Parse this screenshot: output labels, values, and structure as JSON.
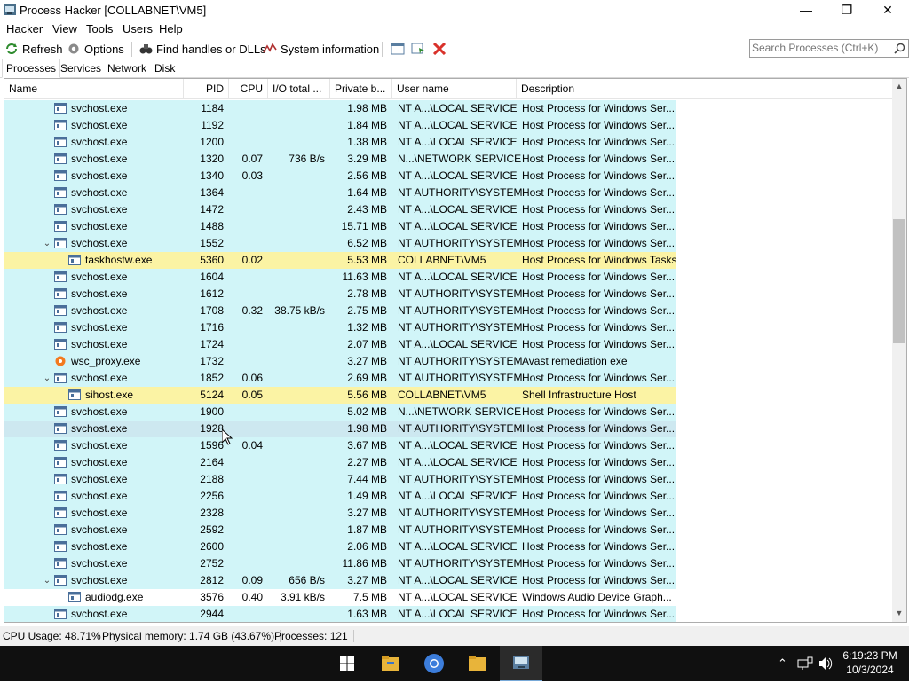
{
  "window": {
    "title": "Process Hacker [COLLABNET\\VM5]",
    "controls": {
      "minimize": "—",
      "maximize": "❐",
      "close": "✕"
    }
  },
  "menu": [
    "Hacker",
    "View",
    "Tools",
    "Users",
    "Help"
  ],
  "toolbar": {
    "refresh": "Refresh",
    "options": "Options",
    "find_handles": "Find handles or DLLs",
    "system_information": "System information"
  },
  "search": {
    "placeholder": "Search Processes (Ctrl+K)"
  },
  "tabs": [
    "Processes",
    "Services",
    "Network",
    "Disk"
  ],
  "columns": {
    "name": "Name",
    "pid": "PID",
    "cpu": "CPU",
    "io": "I/O total ...",
    "private": "Private b...",
    "user": "User name",
    "description": "Description"
  },
  "processes": [
    {
      "name": "svchost.exe",
      "pid": "1184",
      "cpu": "",
      "io": "",
      "priv": "1.98 MB",
      "user": "NT A...\\LOCAL SERVICE",
      "desc": "Host Process for Windows Ser...",
      "indent": 1,
      "kind": "svc",
      "expand": ""
    },
    {
      "name": "svchost.exe",
      "pid": "1192",
      "cpu": "",
      "io": "",
      "priv": "1.84 MB",
      "user": "NT A...\\LOCAL SERVICE",
      "desc": "Host Process for Windows Ser...",
      "indent": 1,
      "kind": "svc",
      "expand": ""
    },
    {
      "name": "svchost.exe",
      "pid": "1200",
      "cpu": "",
      "io": "",
      "priv": "1.38 MB",
      "user": "NT A...\\LOCAL SERVICE",
      "desc": "Host Process for Windows Ser...",
      "indent": 1,
      "kind": "svc",
      "expand": ""
    },
    {
      "name": "svchost.exe",
      "pid": "1320",
      "cpu": "0.07",
      "io": "736 B/s",
      "priv": "3.29 MB",
      "user": "N...\\NETWORK SERVICE",
      "desc": "Host Process for Windows Ser...",
      "indent": 1,
      "kind": "svc",
      "expand": ""
    },
    {
      "name": "svchost.exe",
      "pid": "1340",
      "cpu": "0.03",
      "io": "",
      "priv": "2.56 MB",
      "user": "NT A...\\LOCAL SERVICE",
      "desc": "Host Process for Windows Ser...",
      "indent": 1,
      "kind": "svc",
      "expand": ""
    },
    {
      "name": "svchost.exe",
      "pid": "1364",
      "cpu": "",
      "io": "",
      "priv": "1.64 MB",
      "user": "NT AUTHORITY\\SYSTEM",
      "desc": "Host Process for Windows Ser...",
      "indent": 1,
      "kind": "svc",
      "expand": ""
    },
    {
      "name": "svchost.exe",
      "pid": "1472",
      "cpu": "",
      "io": "",
      "priv": "2.43 MB",
      "user": "NT A...\\LOCAL SERVICE",
      "desc": "Host Process for Windows Ser...",
      "indent": 1,
      "kind": "svc",
      "expand": ""
    },
    {
      "name": "svchost.exe",
      "pid": "1488",
      "cpu": "",
      "io": "",
      "priv": "15.71 MB",
      "user": "NT A...\\LOCAL SERVICE",
      "desc": "Host Process for Windows Ser...",
      "indent": 1,
      "kind": "svc",
      "expand": ""
    },
    {
      "name": "svchost.exe",
      "pid": "1552",
      "cpu": "",
      "io": "",
      "priv": "6.52 MB",
      "user": "NT AUTHORITY\\SYSTEM",
      "desc": "Host Process for Windows Ser...",
      "indent": 1,
      "kind": "svc",
      "expand": "v"
    },
    {
      "name": "taskhostw.exe",
      "pid": "5360",
      "cpu": "0.02",
      "io": "",
      "priv": "5.53 MB",
      "user": "COLLABNET\\VM5",
      "desc": "Host Process for Windows Tasks",
      "indent": 2,
      "kind": "user",
      "expand": ""
    },
    {
      "name": "svchost.exe",
      "pid": "1604",
      "cpu": "",
      "io": "",
      "priv": "11.63 MB",
      "user": "NT A...\\LOCAL SERVICE",
      "desc": "Host Process for Windows Ser...",
      "indent": 1,
      "kind": "svc",
      "expand": ""
    },
    {
      "name": "svchost.exe",
      "pid": "1612",
      "cpu": "",
      "io": "",
      "priv": "2.78 MB",
      "user": "NT AUTHORITY\\SYSTEM",
      "desc": "Host Process for Windows Ser...",
      "indent": 1,
      "kind": "svc",
      "expand": ""
    },
    {
      "name": "svchost.exe",
      "pid": "1708",
      "cpu": "0.32",
      "io": "38.75 kB/s",
      "priv": "2.75 MB",
      "user": "NT AUTHORITY\\SYSTEM",
      "desc": "Host Process for Windows Ser...",
      "indent": 1,
      "kind": "svc",
      "expand": ""
    },
    {
      "name": "svchost.exe",
      "pid": "1716",
      "cpu": "",
      "io": "",
      "priv": "1.32 MB",
      "user": "NT AUTHORITY\\SYSTEM",
      "desc": "Host Process for Windows Ser...",
      "indent": 1,
      "kind": "svc",
      "expand": ""
    },
    {
      "name": "svchost.exe",
      "pid": "1724",
      "cpu": "",
      "io": "",
      "priv": "2.07 MB",
      "user": "NT A...\\LOCAL SERVICE",
      "desc": "Host Process for Windows Ser...",
      "indent": 1,
      "kind": "svc",
      "expand": ""
    },
    {
      "name": "wsc_proxy.exe",
      "pid": "1732",
      "cpu": "",
      "io": "",
      "priv": "3.27 MB",
      "user": "NT AUTHORITY\\SYSTEM",
      "desc": "Avast remediation exe",
      "indent": 1,
      "kind": "svc",
      "expand": "",
      "icon": "avast"
    },
    {
      "name": "svchost.exe",
      "pid": "1852",
      "cpu": "0.06",
      "io": "",
      "priv": "2.69 MB",
      "user": "NT AUTHORITY\\SYSTEM",
      "desc": "Host Process for Windows Ser...",
      "indent": 1,
      "kind": "svc",
      "expand": "v"
    },
    {
      "name": "sihost.exe",
      "pid": "5124",
      "cpu": "0.05",
      "io": "",
      "priv": "5.56 MB",
      "user": "COLLABNET\\VM5",
      "desc": "Shell Infrastructure Host",
      "indent": 2,
      "kind": "user",
      "expand": ""
    },
    {
      "name": "svchost.exe",
      "pid": "1900",
      "cpu": "",
      "io": "",
      "priv": "5.02 MB",
      "user": "N...\\NETWORK SERVICE",
      "desc": "Host Process for Windows Ser...",
      "indent": 1,
      "kind": "svc",
      "expand": ""
    },
    {
      "name": "svchost.exe",
      "pid": "1928",
      "cpu": "",
      "io": "",
      "priv": "1.98 MB",
      "user": "NT AUTHORITY\\SYSTEM",
      "desc": "Host Process for Windows Ser...",
      "indent": 1,
      "kind": "sel",
      "expand": ""
    },
    {
      "name": "svchost.exe",
      "pid": "1596",
      "cpu": "0.04",
      "io": "",
      "priv": "3.67 MB",
      "user": "NT A...\\LOCAL SERVICE",
      "desc": "Host Process for Windows Ser...",
      "indent": 1,
      "kind": "svc",
      "expand": ""
    },
    {
      "name": "svchost.exe",
      "pid": "2164",
      "cpu": "",
      "io": "",
      "priv": "2.27 MB",
      "user": "NT A...\\LOCAL SERVICE",
      "desc": "Host Process for Windows Ser...",
      "indent": 1,
      "kind": "svc",
      "expand": ""
    },
    {
      "name": "svchost.exe",
      "pid": "2188",
      "cpu": "",
      "io": "",
      "priv": "7.44 MB",
      "user": "NT AUTHORITY\\SYSTEM",
      "desc": "Host Process for Windows Ser...",
      "indent": 1,
      "kind": "svc",
      "expand": ""
    },
    {
      "name": "svchost.exe",
      "pid": "2256",
      "cpu": "",
      "io": "",
      "priv": "1.49 MB",
      "user": "NT A...\\LOCAL SERVICE",
      "desc": "Host Process for Windows Ser...",
      "indent": 1,
      "kind": "svc",
      "expand": ""
    },
    {
      "name": "svchost.exe",
      "pid": "2328",
      "cpu": "",
      "io": "",
      "priv": "3.27 MB",
      "user": "NT AUTHORITY\\SYSTEM",
      "desc": "Host Process for Windows Ser...",
      "indent": 1,
      "kind": "svc",
      "expand": ""
    },
    {
      "name": "svchost.exe",
      "pid": "2592",
      "cpu": "",
      "io": "",
      "priv": "1.87 MB",
      "user": "NT AUTHORITY\\SYSTEM",
      "desc": "Host Process for Windows Ser...",
      "indent": 1,
      "kind": "svc",
      "expand": ""
    },
    {
      "name": "svchost.exe",
      "pid": "2600",
      "cpu": "",
      "io": "",
      "priv": "2.06 MB",
      "user": "NT A...\\LOCAL SERVICE",
      "desc": "Host Process for Windows Ser...",
      "indent": 1,
      "kind": "svc",
      "expand": ""
    },
    {
      "name": "svchost.exe",
      "pid": "2752",
      "cpu": "",
      "io": "",
      "priv": "11.86 MB",
      "user": "NT AUTHORITY\\SYSTEM",
      "desc": "Host Process for Windows Ser...",
      "indent": 1,
      "kind": "svc",
      "expand": ""
    },
    {
      "name": "svchost.exe",
      "pid": "2812",
      "cpu": "0.09",
      "io": "656 B/s",
      "priv": "3.27 MB",
      "user": "NT A...\\LOCAL SERVICE",
      "desc": "Host Process for Windows Ser...",
      "indent": 1,
      "kind": "svc",
      "expand": "v"
    },
    {
      "name": "audiodg.exe",
      "pid": "3576",
      "cpu": "0.40",
      "io": "3.91 kB/s",
      "priv": "7.5 MB",
      "user": "NT A...\\LOCAL SERVICE",
      "desc": "Windows Audio Device Graph...",
      "indent": 2,
      "kind": "plain",
      "expand": ""
    },
    {
      "name": "svchost.exe",
      "pid": "2944",
      "cpu": "",
      "io": "",
      "priv": "1.63 MB",
      "user": "NT A...\\LOCAL SERVICE",
      "desc": "Host Process for Windows Ser...",
      "indent": 1,
      "kind": "svc",
      "expand": ""
    }
  ],
  "status": {
    "cpu_usage": "CPU Usage: 48.71%",
    "physical_memory": "Physical memory: 1.74 GB (43.67%)",
    "processes": "Processes: 121"
  },
  "taskbar": {
    "apps": [
      "start-icon",
      "file-explorer-icon",
      "chrome-icon",
      "folder-icon",
      "process-hacker-icon"
    ],
    "time": "6:19:23 PM",
    "date": "10/3/2024"
  },
  "colors": {
    "service_row": "#d1f5f8",
    "user_row": "#fbf3a4",
    "selected_row": "#cde8f0"
  }
}
